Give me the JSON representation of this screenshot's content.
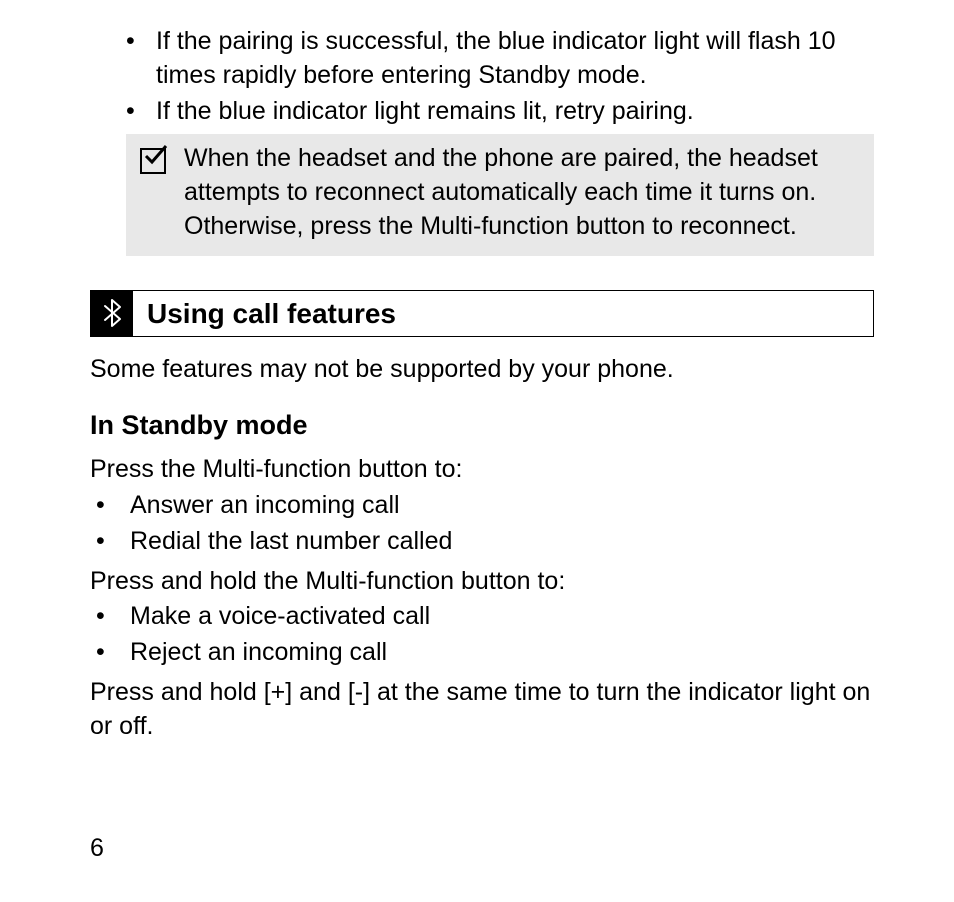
{
  "pairing_list": [
    "If the pairing is successful, the blue indicator light will flash 10 times rapidly before entering Standby mode.",
    "If the blue indicator light remains lit, retry pairing."
  ],
  "note_text": "When the headset and the phone are paired, the headset attempts to reconnect automatically each time it turns on. Otherwise, press the Multi-function button to reconnect.",
  "section_title": "Using call features",
  "intro": "Some features may not be supported by your phone.",
  "sub_heading": "In Standby mode",
  "press_intro": "Press the Multi-function button to:",
  "press_list": [
    "Answer an incoming call",
    "Redial the last number called"
  ],
  "hold_intro": "Press and hold the Multi-function button to:",
  "hold_list": [
    "Make a voice-activated call",
    "Reject an incoming call"
  ],
  "indicator_para": "Press and hold [+] and [-] at the same time to turn the indicator light on or off.",
  "page_number": "6"
}
